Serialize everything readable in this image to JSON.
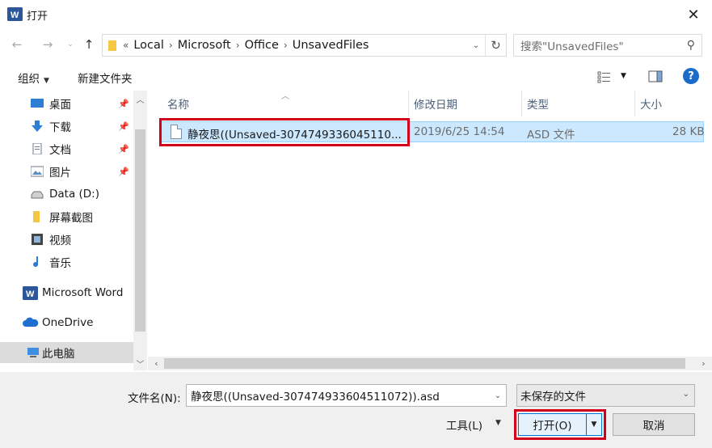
{
  "window": {
    "title": "打开",
    "app_icon_letter": "W"
  },
  "nav": {
    "path": [
      "Local",
      "Microsoft",
      "Office",
      "UnsavedFiles"
    ],
    "overflow_glyph": "«",
    "search_placeholder": "搜索\"UnsavedFiles\""
  },
  "toolbar": {
    "organize": "组织",
    "new_folder": "新建文件夹",
    "help": "?"
  },
  "sidebar": {
    "items": [
      {
        "label": "桌面",
        "icon": "desktop-icon",
        "pinned": true
      },
      {
        "label": "下载",
        "icon": "download-icon",
        "pinned": true
      },
      {
        "label": "文档",
        "icon": "document-icon",
        "pinned": true
      },
      {
        "label": "图片",
        "icon": "pictures-icon",
        "pinned": true
      },
      {
        "label": "Data (D:)",
        "icon": "drive-icon",
        "pinned": false
      },
      {
        "label": "屏幕截图",
        "icon": "folder-icon",
        "pinned": false
      },
      {
        "label": "视频",
        "icon": "video-icon",
        "pinned": false
      },
      {
        "label": "音乐",
        "icon": "music-icon",
        "pinned": false
      },
      {
        "label": "Microsoft Word",
        "icon": "word-icon",
        "pinned": false
      },
      {
        "label": "OneDrive",
        "icon": "onedrive-icon",
        "pinned": false
      },
      {
        "label": "此电脑",
        "icon": "computer-icon",
        "pinned": false
      }
    ]
  },
  "columns": {
    "name": "名称",
    "modified": "修改日期",
    "type": "类型",
    "size": "大小"
  },
  "files": [
    {
      "name": "静夜思((Unsaved-3074749336045110...",
      "modified": "2019/6/25 14:54",
      "type": "ASD 文件",
      "size": "28 KB"
    }
  ],
  "footer": {
    "filename_label": "文件名(N):",
    "filename_value": "静夜思((Unsaved-307474933604511072)).asd",
    "filetype_value": "未保存的文件",
    "tools_label": "工具(L)",
    "open_label": "打开(O)",
    "cancel_label": "取消"
  },
  "colors": {
    "accent": "#0078d7",
    "highlight_box": "#d3001b",
    "selection": "#cce8ff"
  }
}
